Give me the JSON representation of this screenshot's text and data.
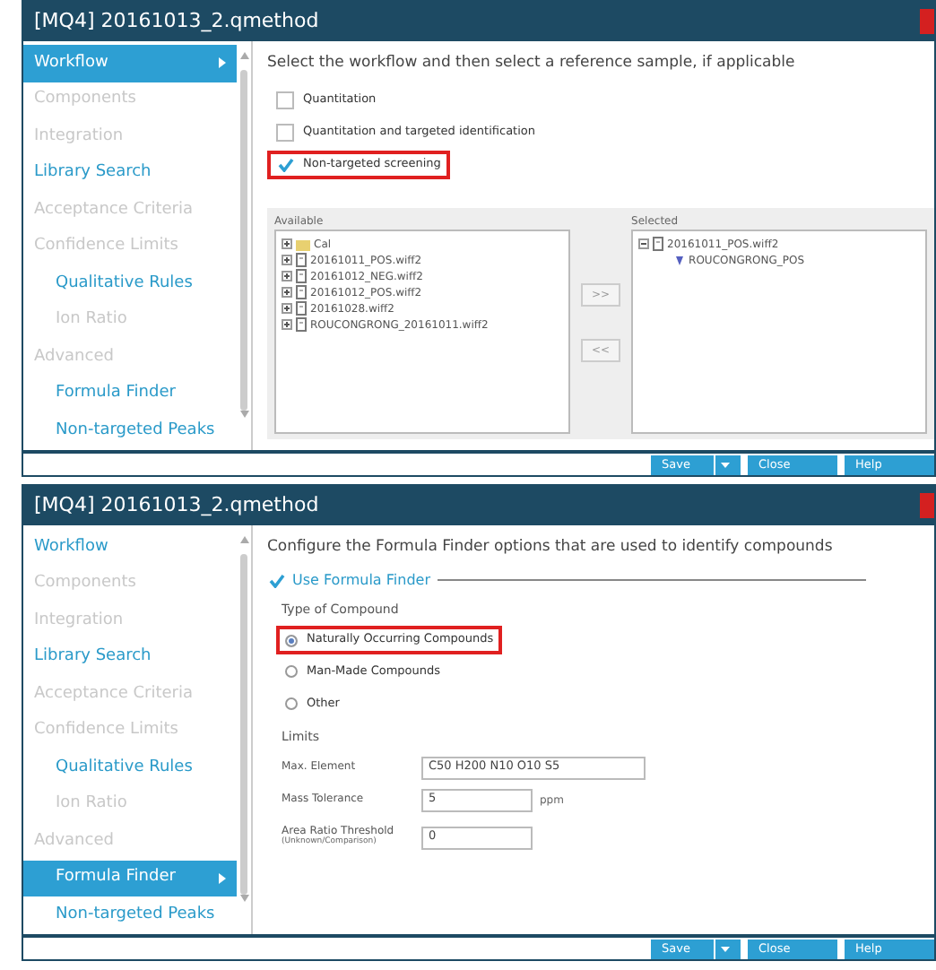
{
  "windows": [
    {
      "title": "[MQ4] 20161013_2.qmethod",
      "sidebar": {
        "items": [
          {
            "label": "Workflow",
            "selected": true,
            "disabled": false
          },
          {
            "label": "Components",
            "selected": false,
            "disabled": true
          },
          {
            "label": "Integration",
            "selected": false,
            "disabled": true
          },
          {
            "label": "Library Search",
            "selected": false,
            "disabled": false
          },
          {
            "label": "Acceptance Criteria",
            "selected": false,
            "disabled": true
          },
          {
            "label": "Confidence Limits",
            "selected": false,
            "disabled": true,
            "children": [
              {
                "label": "Qualitative Rules",
                "selected": false,
                "disabled": false
              },
              {
                "label": "Ion Ratio",
                "selected": false,
                "disabled": true
              }
            ]
          },
          {
            "label": "Advanced",
            "selected": false,
            "disabled": true,
            "children": [
              {
                "label": "Formula Finder",
                "selected": false,
                "disabled": false
              },
              {
                "label": "Non-targeted Peaks",
                "selected": false,
                "disabled": false
              }
            ]
          }
        ]
      },
      "panel": {
        "kind": "workflow",
        "heading": "Select the workflow and then select a reference sample, if applicable",
        "options": [
          {
            "label": "Quantitation",
            "checked": false,
            "highlighted": false
          },
          {
            "label": "Quantitation and targeted identification",
            "checked": false,
            "highlighted": false
          },
          {
            "label": "Non-targeted screening",
            "checked": true,
            "highlighted": true
          }
        ],
        "available": {
          "title": "Available",
          "items": [
            {
              "label": "Cal",
              "kind": "folder",
              "expanded": false
            },
            {
              "label": "20161011_POS.wiff2",
              "kind": "file",
              "expanded": false
            },
            {
              "label": "20161012_NEG.wiff2",
              "kind": "file",
              "expanded": false
            },
            {
              "label": "20161012_POS.wiff2",
              "kind": "file",
              "expanded": false
            },
            {
              "label": "20161028.wiff2",
              "kind": "file",
              "expanded": false
            },
            {
              "label": "ROUCONGRONG_20161011.wiff2",
              "kind": "file",
              "expanded": false
            }
          ]
        },
        "move_buttons": [
          ">>",
          "<<"
        ],
        "selected": {
          "title": "Selected",
          "items": [
            {
              "label": "20161011_POS.wiff2",
              "kind": "file",
              "expanded": true,
              "children": [
                {
                  "label": "ROUCONGRONG_POS",
                  "kind": "sample"
                }
              ]
            }
          ]
        }
      },
      "buttons": [
        {
          "label": "Save",
          "dropdown": true
        },
        {
          "label": "Close",
          "dropdown": false
        },
        {
          "label": "Help",
          "dropdown": false
        }
      ]
    },
    {
      "title": "[MQ4] 20161013_2.qmethod",
      "sidebar": {
        "items": [
          {
            "label": "Workflow",
            "selected": false,
            "disabled": false
          },
          {
            "label": "Components",
            "selected": false,
            "disabled": true
          },
          {
            "label": "Integration",
            "selected": false,
            "disabled": true
          },
          {
            "label": "Library Search",
            "selected": false,
            "disabled": false
          },
          {
            "label": "Acceptance Criteria",
            "selected": false,
            "disabled": true
          },
          {
            "label": "Confidence Limits",
            "selected": false,
            "disabled": true,
            "children": [
              {
                "label": "Qualitative Rules",
                "selected": false,
                "disabled": false
              },
              {
                "label": "Ion Ratio",
                "selected": false,
                "disabled": true
              }
            ]
          },
          {
            "label": "Advanced",
            "selected": false,
            "disabled": true,
            "children": [
              {
                "label": "Formula Finder",
                "selected": true,
                "disabled": false
              },
              {
                "label": "Non-targeted Peaks",
                "selected": false,
                "disabled": false
              }
            ]
          }
        ]
      },
      "panel": {
        "kind": "formula",
        "heading": "Configure the Formula Finder options that are used to identify compounds",
        "enable": {
          "label": "Use Formula Finder",
          "checked": true
        },
        "type_heading": "Type of Compound",
        "types": [
          {
            "label": "Naturally Occurring Compounds",
            "selected": true,
            "highlighted": true
          },
          {
            "label": "Man-Made Compounds",
            "selected": false,
            "highlighted": false
          },
          {
            "label": "Other",
            "selected": false,
            "highlighted": false
          }
        ],
        "limits_heading": "Limits",
        "fields": [
          {
            "label": "Max. Element",
            "value": "C50 H200 N10 O10 S5",
            "wide": true
          },
          {
            "label": "Mass Tolerance",
            "value": "5",
            "unit": "ppm",
            "wide": false
          },
          {
            "label": "Area Ratio Threshold",
            "sublabel": "(Unknown/Comparison)",
            "value": "0",
            "wide": false
          }
        ]
      },
      "buttons": [
        {
          "label": "Save",
          "dropdown": true
        },
        {
          "label": "Close",
          "dropdown": false
        },
        {
          "label": "Help",
          "dropdown": false
        }
      ]
    }
  ]
}
